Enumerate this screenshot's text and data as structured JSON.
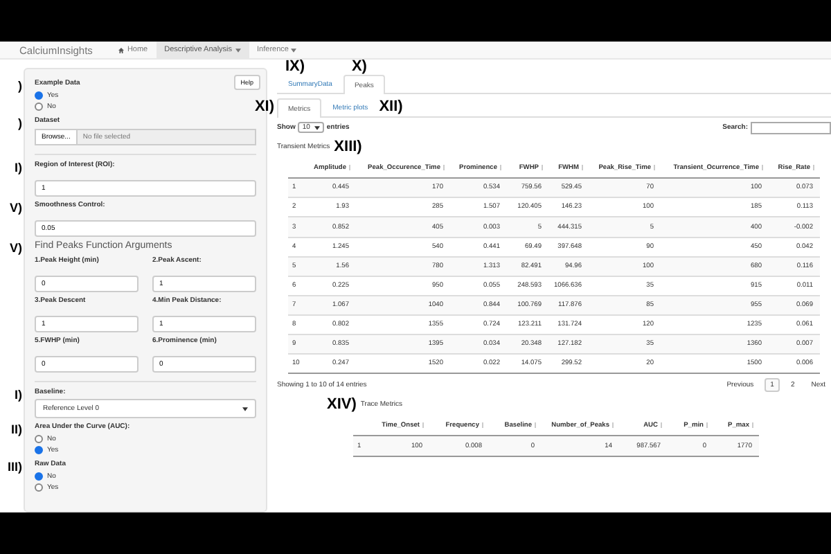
{
  "navbar": {
    "brand": "CalciumInsights",
    "items": [
      {
        "label": "Home",
        "kind": "home",
        "selected": false
      },
      {
        "label": "Descriptive Analysis",
        "kind": "dropdown",
        "selected": true
      },
      {
        "label": "Inference",
        "kind": "dropdown",
        "selected": false
      }
    ]
  },
  "sidebar": {
    "help_button": "Help",
    "example_data": {
      "annotation": ")",
      "label": "Example Data",
      "options": [
        {
          "label": "Yes",
          "selected": true
        },
        {
          "label": "No",
          "selected": false
        }
      ]
    },
    "dataset": {
      "annotation": ")",
      "label": "Dataset",
      "button": "Browse...",
      "placeholder": "No file selected"
    },
    "roi": {
      "annotation": "I)",
      "label": "Region of Interest (ROI):",
      "value": "1"
    },
    "smoothness": {
      "annotation": "V)",
      "label": "Smoothness Control:",
      "value": "0.05"
    },
    "find_peaks": {
      "annotation": "V)",
      "title": "Find Peaks Function Arguments",
      "fields": [
        {
          "label": "1.Peak Height (min)",
          "value": "0"
        },
        {
          "label": "2.Peak Ascent:",
          "value": "1"
        },
        {
          "label": "3.Peak Descent",
          "value": "1"
        },
        {
          "label": "4.Min Peak Distance:",
          "value": "1"
        },
        {
          "label": "5.FWHP (min)",
          "value": "0"
        },
        {
          "label": "6.Prominence (min)",
          "value": "0"
        }
      ]
    },
    "baseline": {
      "annotation": "I)",
      "label": "Baseline:",
      "value": "Reference Level 0"
    },
    "auc": {
      "annotation": "II)",
      "label": "Area Under the Curve (AUC):",
      "options": [
        {
          "label": "No",
          "selected": false
        },
        {
          "label": "Yes",
          "selected": true
        }
      ]
    },
    "raw_data": {
      "annotation": "III)",
      "label": "Raw Data",
      "options": [
        {
          "label": "No",
          "selected": true
        },
        {
          "label": "Yes",
          "selected": false
        }
      ]
    }
  },
  "main": {
    "tabs": [
      {
        "label": "SummaryData",
        "selected": false,
        "annotation": "IX)"
      },
      {
        "label": "Peaks",
        "selected": true,
        "annotation": "X)"
      }
    ],
    "subtabs": [
      {
        "label": "Metrics",
        "selected": true,
        "annotation": "XI)"
      },
      {
        "label": "Metric plots",
        "selected": false,
        "annotation": "XII)"
      }
    ],
    "length": {
      "show": "Show",
      "value": "10",
      "entries": "entries"
    },
    "search_label": "Search:",
    "transient": {
      "title": "Transient Metrics",
      "annotation": "XIII)",
      "columns": [
        "",
        "Amplitude",
        "Peak_Occurence_Time",
        "Prominence",
        "FWHP",
        "FWHM",
        "Peak_Rise_Time",
        "Transient_Ocurrence_Time",
        "Rise_Rate"
      ],
      "rows": [
        [
          "1",
          "0.445",
          "170",
          "0.534",
          "759.56",
          "529.45",
          "70",
          "100",
          "0.073"
        ],
        [
          "2",
          "1.93",
          "285",
          "1.507",
          "120.405",
          "146.23",
          "100",
          "185",
          "0.113"
        ],
        [
          "3",
          "0.852",
          "405",
          "0.003",
          "5",
          "444.315",
          "5",
          "400",
          "-0.002"
        ],
        [
          "4",
          "1.245",
          "540",
          "0.441",
          "69.49",
          "397.648",
          "90",
          "450",
          "0.042"
        ],
        [
          "5",
          "1.56",
          "780",
          "1.313",
          "82.491",
          "94.96",
          "100",
          "680",
          "0.116"
        ],
        [
          "6",
          "0.225",
          "950",
          "0.055",
          "248.593",
          "1066.636",
          "35",
          "915",
          "0.011"
        ],
        [
          "7",
          "1.067",
          "1040",
          "0.844",
          "100.769",
          "117.876",
          "85",
          "955",
          "0.069"
        ],
        [
          "8",
          "0.802",
          "1355",
          "0.724",
          "123.211",
          "131.724",
          "120",
          "1235",
          "0.061"
        ],
        [
          "9",
          "0.835",
          "1395",
          "0.034",
          "20.348",
          "127.182",
          "35",
          "1360",
          "0.007"
        ],
        [
          "10",
          "0.247",
          "1520",
          "0.022",
          "14.075",
          "299.52",
          "20",
          "1500",
          "0.006"
        ]
      ]
    },
    "info": "Showing 1 to 10 of 14 entries",
    "pagination": {
      "previous": "Previous",
      "pages": [
        {
          "label": "1",
          "selected": true
        },
        {
          "label": "2",
          "selected": false
        }
      ],
      "next": "Next"
    },
    "trace": {
      "title": "Trace Metrics",
      "annotation": "XIV)",
      "columns": [
        "",
        "Time_Onset",
        "Frequency",
        "Baseline",
        "Number_of_Peaks",
        "AUC",
        "P_min",
        "P_max"
      ],
      "rows": [
        [
          "1",
          "100",
          "0.008",
          "0",
          "14",
          "987.567",
          "0",
          "1770"
        ]
      ]
    }
  }
}
